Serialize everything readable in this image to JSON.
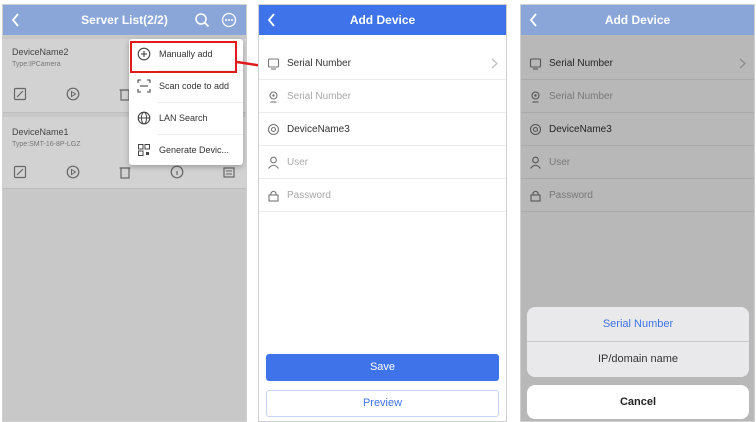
{
  "panel1": {
    "title": "Server List(2/2)",
    "devices": [
      {
        "name": "DeviceName2",
        "type": "Type:IPCamera"
      },
      {
        "name": "DeviceName1",
        "type": "Type:SMT-16-8P-LGZ"
      }
    ],
    "menu": [
      {
        "label": "Manually add",
        "icon": "plus-circle-icon"
      },
      {
        "label": "Scan code to add",
        "icon": "scan-icon"
      },
      {
        "label": "LAN Search",
        "icon": "globe-icon"
      },
      {
        "label": "Generate Devic...",
        "icon": "qr-icon"
      }
    ]
  },
  "panel2": {
    "title": "Add Device",
    "fields": [
      {
        "text": "Serial Number",
        "placeholder": false,
        "icon": "device-icon"
      },
      {
        "text": "Serial Number",
        "placeholder": true,
        "icon": "location-icon"
      },
      {
        "text": "DeviceName3",
        "placeholder": false,
        "icon": "tag-icon"
      },
      {
        "text": "User",
        "placeholder": true,
        "icon": "user-icon"
      },
      {
        "text": "Password",
        "placeholder": true,
        "icon": "lock-icon"
      }
    ],
    "save_label": "Save",
    "preview_label": "Preview"
  },
  "panel3": {
    "title": "Add Device",
    "fields": [
      {
        "text": "Serial Number",
        "placeholder": false,
        "icon": "device-icon"
      },
      {
        "text": "Serial Number",
        "placeholder": true,
        "icon": "location-icon"
      },
      {
        "text": "DeviceName3",
        "placeholder": false,
        "icon": "tag-icon"
      },
      {
        "text": "User",
        "placeholder": true,
        "icon": "user-icon"
      },
      {
        "text": "Password",
        "placeholder": true,
        "icon": "lock-icon"
      }
    ],
    "sheet": {
      "option1": "Serial Number",
      "option2": "IP/domain name",
      "cancel": "Cancel"
    }
  },
  "colors": {
    "accent": "#3e73e9",
    "highlight": "#e11b1b"
  }
}
